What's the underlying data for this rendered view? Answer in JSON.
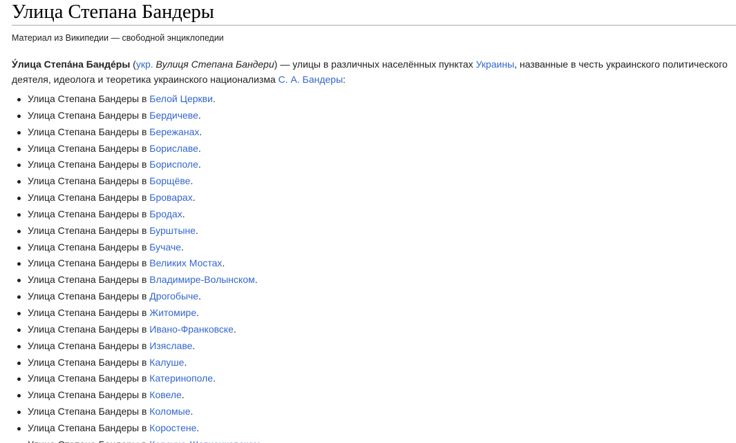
{
  "page": {
    "title": "Улица Степана Бандеры",
    "tagline": "Материал из Википедии — свободной энциклопедии"
  },
  "intro": {
    "bold_name": "У́лица Степа́на Банде́ры",
    "open_paren": " (",
    "lang_link": "укр.",
    "ukr_name": " Вулиця Степана Бандери",
    "text1": ") — улицы в различных населённых пунктах ",
    "country_link": "Украины",
    "text2": ", названные в честь украинского политического деятеля, идеолога и теоретика украинского национализма ",
    "person_link": "С. А. Бандеры",
    "text3": ":"
  },
  "list_prefix": "Улица Степана Бандеры в ",
  "list_suffix": ".",
  "cities": [
    "Белой Церкви",
    "Бердичеве",
    "Бережанах",
    "Бориславе",
    "Борисполе",
    "Борщёве",
    "Броварах",
    "Бродах",
    "Бурштыне",
    "Бучаче",
    "Великих Мостах",
    "Владимире-Волынском",
    "Дрогобыче",
    "Житомире",
    "Ивано-Франковске",
    "Изяславе",
    "Калуше",
    "Катеринополе",
    "Ковеле",
    "Коломые",
    "Коростене",
    "Корсуне-Шевченковском"
  ],
  "colors": {
    "link": "#3366cc",
    "text": "#202122",
    "rule": "#a2a9b1"
  }
}
